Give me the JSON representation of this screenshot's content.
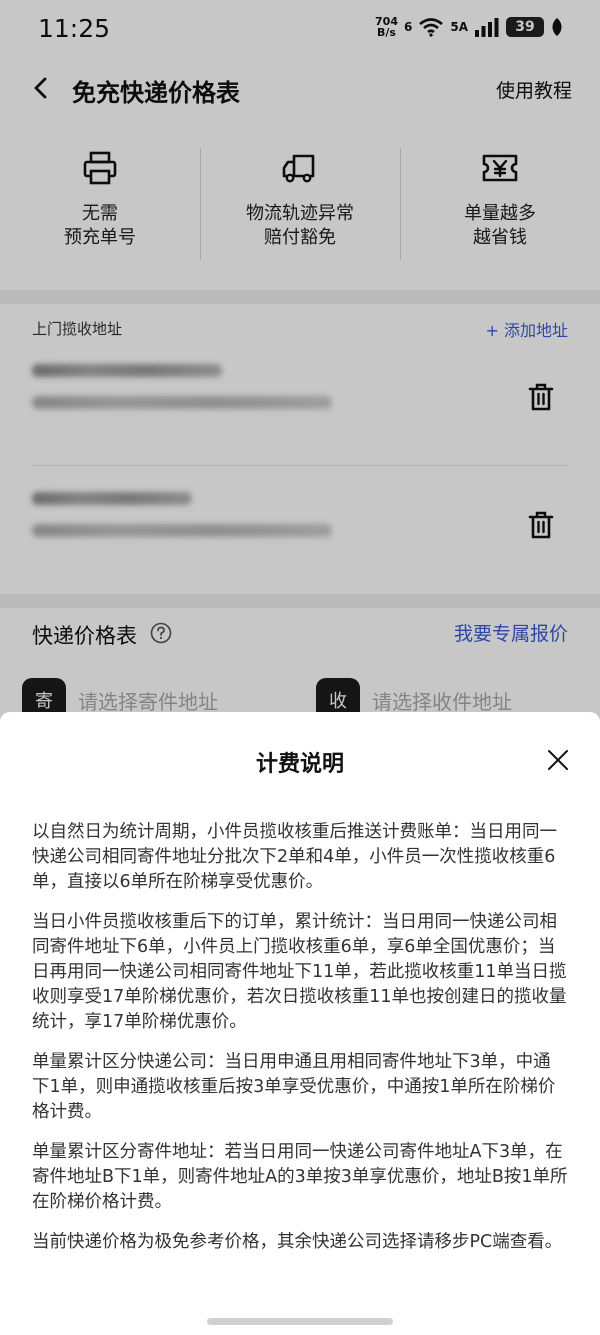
{
  "status_bar": {
    "time": "11:25",
    "net_speed_value": "704",
    "net_speed_unit": "B/s",
    "wifi_label": "6",
    "cell_label": "5A",
    "battery": "39"
  },
  "nav": {
    "title": "免充快递价格表",
    "tutorial": "使用教程"
  },
  "features": [
    {
      "icon": "printer-icon",
      "text": "无需\n预充单号"
    },
    {
      "icon": "truck-icon",
      "text": "物流轨迹异常\n赔付豁免"
    },
    {
      "icon": "yen-ticket-icon",
      "text": "单量越多\n越省钱"
    }
  ],
  "address": {
    "heading": "上门揽收地址",
    "add_label": "+ 添加地址"
  },
  "price": {
    "title": "快递价格表",
    "quote_link": "我要专属报价",
    "sender_badge": "寄",
    "sender_placeholder": "请选择寄件地址",
    "receiver_badge": "收",
    "receiver_placeholder": "请选择收件地址"
  },
  "sheet": {
    "title": "计费说明",
    "paragraphs": [
      "以自然日为统计周期，小件员揽收核重后推送计费账单：当日用同一快递公司相同寄件地址分批次下2单和4单，小件员一次性揽收核重6单，直接以6单所在阶梯享受优惠价。",
      "当日小件员揽收核重后下的订单，累计统计：当日用同一快递公司相同寄件地址下6单，小件员上门揽收核重6单，享6单全国优惠价；当日再用同一快递公司相同寄件地址下11单，若此揽收核重11单当日揽收则享受17单阶梯优惠价，若次日揽收核重11单也按创建日的揽收量统计，享17单阶梯优惠价。",
      "单量累计区分快递公司：当日用申通且用相同寄件地址下3单，中通下1单，则申通揽收核重后按3单享受优惠价，中通按1单所在阶梯价格计费。",
      "单量累计区分寄件地址：若当日用同一快递公司寄件地址A下3单，在寄件地址B下1单，则寄件地址A的3单按3单享优惠价，地址B按1单所在阶梯价格计费。",
      "当前快递价格为极免参考价格，其余快递公司选择请移步PC端查看。"
    ]
  }
}
